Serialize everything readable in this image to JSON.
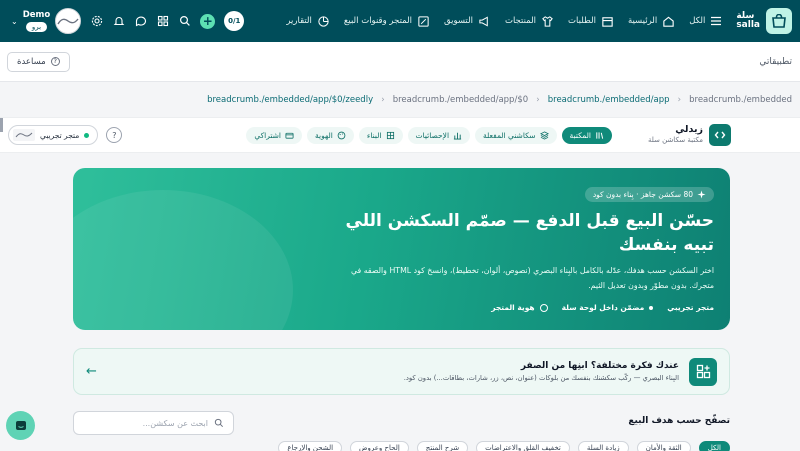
{
  "topnav": {
    "brand_top": "سلة",
    "brand_bottom": "salla",
    "items": [
      {
        "label": "الكل",
        "icon": "menu-icon"
      },
      {
        "label": "الرئيسية",
        "icon": "home-icon"
      },
      {
        "label": "الطلبات",
        "icon": "box-icon"
      },
      {
        "label": "المنتجات",
        "icon": "tshirt-icon"
      },
      {
        "label": "التسويق",
        "icon": "megaphone-icon"
      },
      {
        "label": "المتجر وقنوات البيع",
        "icon": "store-icon"
      },
      {
        "label": "التقارير",
        "icon": "chart-icon"
      }
    ],
    "counter": "0/1",
    "user_name": "Demo",
    "user_plan": "برو"
  },
  "page": {
    "title": "تطبيقاتي",
    "help_label": "مساعدة"
  },
  "breadcrumb": [
    "breadcrumb./embedded",
    "breadcrumb./embedded/app",
    "breadcrumb./embedded/app/$0",
    "breadcrumb./embedded/app/$0/zeedly"
  ],
  "app": {
    "name": "زيدلي",
    "subtitle": "مكتبة سكاشن سلة",
    "tabs": [
      {
        "label": "المكتبة",
        "active": true
      },
      {
        "label": "سكاشني المفعلة",
        "active": false
      },
      {
        "label": "الإحصائيات",
        "active": false
      },
      {
        "label": "البناء",
        "active": false
      },
      {
        "label": "الهوية",
        "active": false
      },
      {
        "label": "اشتراكي",
        "active": false
      }
    ],
    "store_label": "متجر تجريبي"
  },
  "hero": {
    "badge": "80 سكشن جاهز · بِناء بدون كود",
    "title": "حسّن البيع قبل الدفع — صمّم السكشن اللي تبيه بنفسك",
    "description": "اختر السكشن حسب هدفك، عدّله بالكامل بالبِناء البصري (نصوص، ألوان، تخطيط)، وانسخ كود HTML والصقه في متجرك. بدون مطوّر وبدون تعديل الثيم.",
    "chips": [
      "متجر تجريبي",
      "مضمّن داخل لوحة سلة",
      "هوية المتجر"
    ]
  },
  "idea": {
    "title": "عندك فكرة مختلفة؟ ابنِها من الصفر",
    "subtitle": "البِناء البصري — ركّب سكشنك بنفسك من بلوكات (عنوان، نص، زر، شارات، بطاقات...) بدون كود."
  },
  "filter": {
    "title": "تصفّح حسب هدف البيع",
    "search_placeholder": "ابحث عن سكشن..."
  },
  "pills": [
    {
      "label": "الكل",
      "active": true
    },
    {
      "label": "الثقة والأمان",
      "active": false
    },
    {
      "label": "زيادة السلة",
      "active": false
    },
    {
      "label": "تخفيف القلق والاعتراضات",
      "active": false
    },
    {
      "label": "شرح المنتج",
      "active": false
    },
    {
      "label": "إلحاح وعروض",
      "active": false
    },
    {
      "label": "الشحن والإرجاع",
      "active": false
    }
  ]
}
